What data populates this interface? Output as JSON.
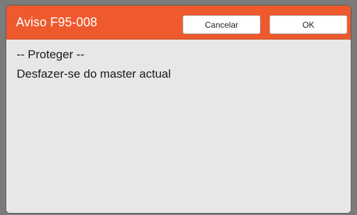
{
  "dialog": {
    "title": "Aviso F95-008",
    "cancel_label": "Cancelar",
    "ok_label": "OK",
    "message_lines": [
      "-- Proteger --",
      "Desfazer-se do master actual"
    ]
  },
  "colors": {
    "titlebar": "#ee5a2e",
    "content_background": "#e7e7e7",
    "button_background": "#ffffff"
  }
}
